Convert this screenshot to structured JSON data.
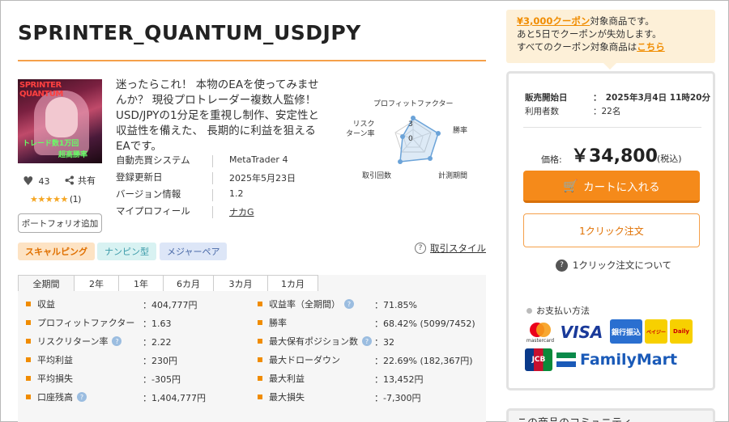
{
  "product": {
    "title": "SPRINTER_QUANTUM_USDJPY",
    "image_texts": [
      "SPRINTER QUANTUM",
      "トレード数1万回",
      "超高勝率"
    ],
    "catch_copy": "迷ったらこれ！ 本物のEAを使ってみませんか？ 現役プロトレーダー複数人監修！USD/JPYの1分足を重視し制作、安定性と収益性を備えた、 長期的に利益を狙えるEAです。",
    "likes": "43",
    "share_label": "共有",
    "stars": "★★★★★",
    "review_count": "(1)",
    "portfolio_button": "ポートフォリオ追加"
  },
  "radar": {
    "labels": {
      "profit_factor": "プロフィットファクター",
      "win_rate": "勝率",
      "period": "計測期間",
      "trades": "取引回数",
      "risk_return": "リスク\nターン率"
    },
    "ticks": [
      "3",
      "0"
    ]
  },
  "info": [
    {
      "key": "自動売買システム",
      "value": "MetaTrader 4"
    },
    {
      "key": "登録更新日",
      "value": "2025年5月23日"
    },
    {
      "key": "バージョン情報",
      "value": "1.2"
    },
    {
      "key": "マイプロフィール",
      "value": "ナカG"
    }
  ],
  "tags": [
    "スキャルピング",
    "ナンピン型",
    "メジャーペア"
  ],
  "trade_style_label": "取引スタイル",
  "tabs": [
    "全期間",
    "2年",
    "1年",
    "6カ月",
    "3カ月",
    "1カ月"
  ],
  "stats_left": [
    {
      "key": "収益",
      "value": "：404,777円",
      "help": false
    },
    {
      "key": "プロフィットファクター",
      "value": "：1.63",
      "help": false
    },
    {
      "key": "リスクリターン率",
      "value": "：2.22",
      "help": true
    },
    {
      "key": "平均利益",
      "value": "：230円",
      "help": false
    },
    {
      "key": "平均損失",
      "value": "：-305円",
      "help": false
    },
    {
      "key": "口座残高",
      "value": "：1,404,777円",
      "help": true
    }
  ],
  "stats_right": [
    {
      "key": "収益率（全期間）",
      "value": "：71.85%",
      "help": true
    },
    {
      "key": "勝率",
      "value": "：68.42% (5099/7452)",
      "help": false
    },
    {
      "key": "最大保有ポジション数",
      "value": "：32",
      "help": true
    },
    {
      "key": "最大ドローダウン",
      "value": "：22.69% (182,367円)",
      "help": false
    },
    {
      "key": "最大利益",
      "value": "：13,452円",
      "help": false
    },
    {
      "key": "最大損失",
      "value": "：-7,300円",
      "help": false
    }
  ],
  "coupon": {
    "highlight": "¥3,000クーポン",
    "line1_rest": "対象商品です。",
    "line2": "あと5日でクーポンが失効します。",
    "line3_pre": "すべてのクーポン対象商品は",
    "line3_link": "こちら"
  },
  "buybox": {
    "sale_start_key": "販売開始日",
    "sale_start_value": "：　2025年3月4日 11時20分",
    "users_key": "利用者数",
    "users_value": "：22名",
    "price_label": "価格:",
    "price": "￥34,800",
    "tax": "(税込)",
    "cart_button": "カートに入れる",
    "oneclick_button": "1クリック注文",
    "oneclick_help": "1クリック注文について",
    "payment_title": "お支払い方法",
    "payments": [
      "mastercard",
      "VISA",
      "銀行振込",
      "ペイジー",
      "Daily",
      "JCB",
      "FamilyMart"
    ]
  },
  "community_title": "この商品のコミュニティ"
}
